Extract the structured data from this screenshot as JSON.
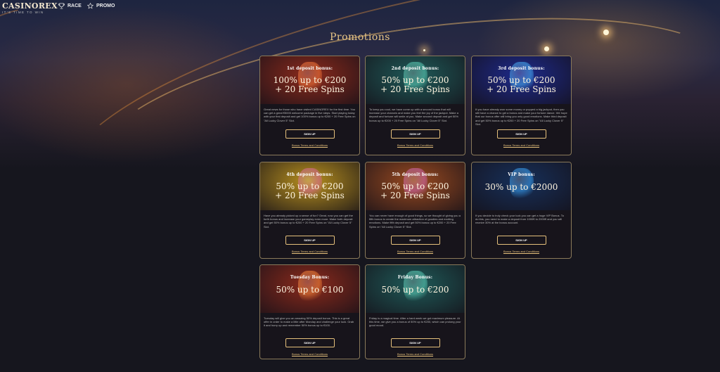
{
  "header": {
    "logo_main": "CASINOREX",
    "logo_sub": "IT'S TIME TO WIN",
    "nav": [
      {
        "label": "RACE",
        "icon": "trophy-icon"
      },
      {
        "label": "PROMO",
        "icon": "star-icon"
      }
    ]
  },
  "page_title": "Promotions",
  "cards": [
    {
      "label": "1st deposit bonus:",
      "amount_line1": "100% up to €200",
      "amount_line2": "+ 20 Free Spins",
      "description": "Great news for those who have visited CASINOREX for the first time. You can get a great €5000 welcome package in five steps. Start playing today with your first deposit and get 100% bonus up to €200 + 20 Free Spins on \"All Lucky Clover 5\" Slot.",
      "button": "SIGN UP",
      "terms": "Bonus Terms and Conditions",
      "theme": "red"
    },
    {
      "label": "2nd deposit bonus:",
      "amount_line1": "50% up to €200",
      "amount_line2": "+ 20 Free Spins",
      "description": "To keep you cool, we have come up with a second bonus that will increase your chances and make you feel the joy of the jackpot. Make a deposit and fortune will smile at you. Make second deposit and get 50% bonus up to €200 + 20 Free Spins on \"All Lucky Clover 5\" Slot.",
      "button": "SIGN UP",
      "terms": "Bonus Terms and Conditions",
      "theme": "teal"
    },
    {
      "label": "3rd deposit bonus:",
      "amount_line1": "50% up to €200",
      "amount_line2": "+ 20 Free Spins",
      "description": "If you have already won some money or popped a big jackpot, then you still have a chance to get a bonus and make your fortune dance. We hope that our bonus offer will bring you only good emotions. Make third deposit and get 50% bonus up to €200 + 20 Free Spins on \"All Lucky Clover 5\" Slot.",
      "button": "SIGN UP",
      "terms": "Bonus Terms and Conditions",
      "theme": "blue"
    },
    {
      "label": "4th deposit bonus:",
      "amount_line1": "50% up to €200",
      "amount_line2": "+ 20 Free Spins",
      "description": "Have you already picked up a sense of fun? Great, now you can get the forth bonus and increase your gameplay even more. Make forth deposit and get 50% bonus up to €200 + 20 Free Spins on \"All Lucky Clover 5\" Slot.",
      "button": "SIGN UP",
      "terms": "Bonus Terms and Conditions",
      "theme": "gold"
    },
    {
      "label": "5th deposit bonus:",
      "amount_line1": "50% up to €200",
      "amount_line2": "+ 20 Free Spins",
      "description": "You can never have enough of good things, so we thought of giving you a fifth bonus to create the maximum attraction of goodies and exciting emotions. Make fifth deposit and get 50% bonus up to €200 + 20 Free Spins on \"All Lucky Clover 5\" Slot.",
      "button": "SIGN UP",
      "terms": "Bonus Terms and Conditions",
      "theme": "orange"
    },
    {
      "label": "VIP bonus:",
      "amount_line1": "30% up to €2000",
      "amount_line2": "",
      "description": "If you decide to truly check your luck you can get a huge VIP Bonus. To do this, you need to make a deposit from 1000€ to 2000€ and you will receive 30% at the bonus account.",
      "button": "SIGN UP",
      "terms": "Bonus Terms and Conditions",
      "theme": "vip"
    },
    {
      "label": "Tuesday Bonus:",
      "amount_line1": "50% up to €100",
      "amount_line2": "",
      "description": "Tuesday will give you an amazing 50% deposit bonus. This is a great offer in order to make a little after Monday and challenge your luck. Grab it and hurry up and remember 50% bonus up to €100.",
      "button": "SIGN UP",
      "terms": "Bonus Terms and Conditions",
      "theme": "red"
    },
    {
      "label": "Friday Bonus:",
      "amount_line1": "50% up to €200",
      "amount_line2": "",
      "description": "Friday is a magical time. After a hard week we got maximum pleasure. At this time, we give you a bonus of 50% up to €200, which can prolong your good mood.",
      "button": "SIGN UP",
      "terms": "Bonus Terms and Conditions",
      "theme": "teal"
    }
  ],
  "themes": {
    "red": "#8c2a1c",
    "teal": "#1f5a58",
    "blue": "#1e2a8c",
    "gold": "#b8901e",
    "orange": "#9a4a20",
    "vip": "#17305a"
  },
  "colors": {
    "accent": "#e5c07b",
    "title": "#e7c585",
    "background": "#16161e"
  }
}
